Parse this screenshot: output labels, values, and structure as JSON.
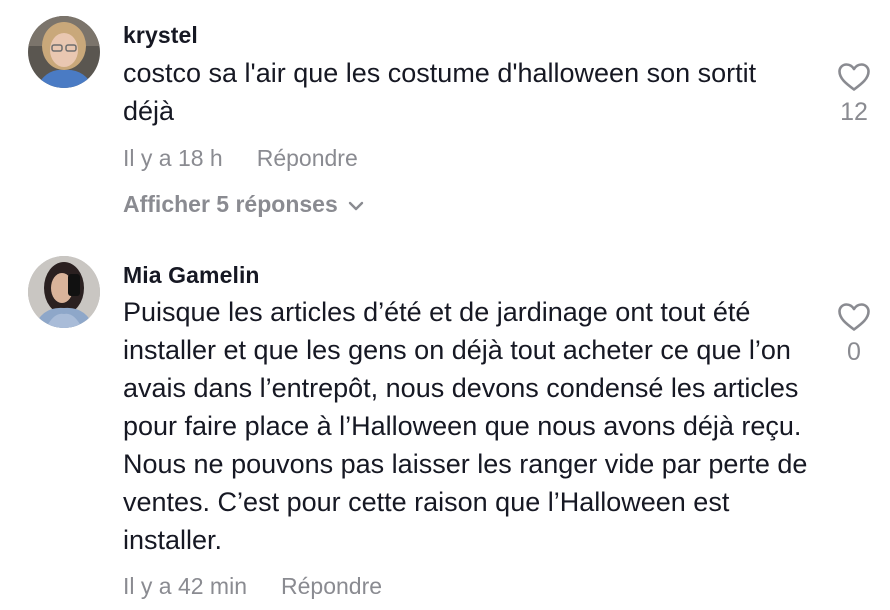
{
  "comments": [
    {
      "username": "krystel",
      "text": "costco sa l'air que les costume d'halloween son sortit déjà",
      "time": "Il y a 18 h",
      "reply_label": "Répondre",
      "view_replies_label": "Afficher 5 réponses",
      "like_count": "12",
      "avatar": {
        "bg": "#5a5650",
        "skin": "#e9c7b1",
        "hair": "#c9a87a",
        "shirt": "#4a7bc4"
      }
    },
    {
      "username": "Mia Gamelin",
      "text": "Puisque les articles d’été et de jardinage ont tout été installer et que les gens on déjà tout acheter ce que l’on avais dans l’entrepôt, nous devons condensé les articles pour faire place à l’Halloween que nous avons déjà reçu. Nous ne pouvons pas laisser les ranger vide par perte de ventes. C’est pour cette raison que l’Halloween est installer.",
      "time": "Il y a 42 min",
      "reply_label": "Répondre",
      "like_count": "0",
      "avatar": {
        "bg": "#b8b6b4",
        "skin": "#d9b39a",
        "hair": "#2a2020",
        "shirt": "#8ea7c9"
      }
    }
  ],
  "icons": {
    "like": "heart-outline-icon",
    "expand": "chevron-down-icon"
  },
  "colors": {
    "text": "#161823",
    "muted": "#8a8b91",
    "background": "#ffffff"
  }
}
